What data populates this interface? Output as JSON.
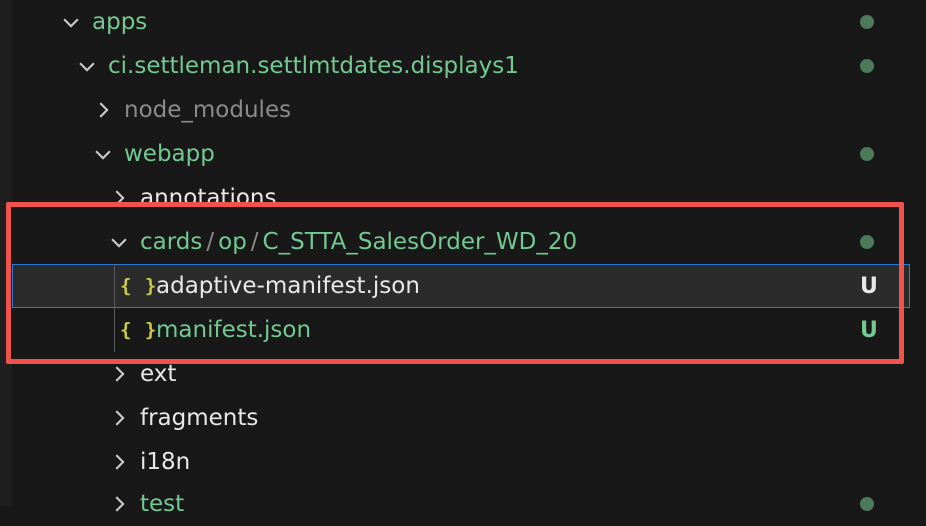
{
  "tree": {
    "apps": {
      "label": "apps"
    },
    "project": {
      "label": "ci.settleman.settlmtdates.displays1"
    },
    "node_modules": {
      "label": "node_modules"
    },
    "webapp": {
      "label": "webapp"
    },
    "annotations": {
      "label": "annotations"
    },
    "cards": {
      "seg1": "cards",
      "seg2": "op",
      "seg3": "C_STTA_SalesOrder_WD_20",
      "sep": "/"
    },
    "adaptive_manifest": {
      "label": "adaptive-manifest.json",
      "icon": "{ }",
      "badge": "U"
    },
    "manifest": {
      "label": "manifest.json",
      "icon": "{ }",
      "badge": "U"
    },
    "ext": {
      "label": "ext"
    },
    "fragments": {
      "label": "fragments"
    },
    "i18n": {
      "label": "i18n"
    },
    "test": {
      "label": "test"
    }
  },
  "colors": {
    "background": "#181818",
    "git_untracked": "#73c991",
    "highlight": "#f0534b",
    "selection_border": "#2a7bd5"
  }
}
